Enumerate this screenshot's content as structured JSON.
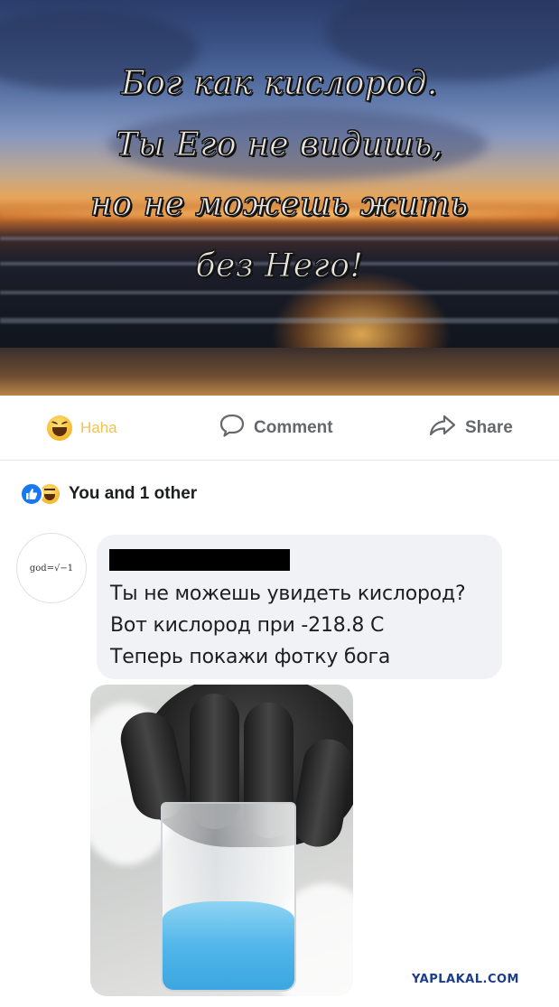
{
  "post": {
    "quote_lines": [
      "Бог как кислород.",
      "Ты Его не видишь,",
      "но не можешь жить",
      "без Него!"
    ]
  },
  "actions": {
    "haha_label": "Haha",
    "comment_label": "Comment",
    "share_label": "Share"
  },
  "reactions": {
    "summary": "You and 1 other"
  },
  "comment": {
    "avatar_text": "god=√−1",
    "lines": [
      "Ты не можешь увидеть кислород?",
      "Вот кислород при -218.8 C",
      "Теперь покажи фотку бога"
    ]
  },
  "watermark": "YAPLAKAL.COM",
  "colors": {
    "link_blue": "#1877f2",
    "haha_yellow": "#f0c34d",
    "bubble_bg": "#f0f2f5",
    "muted_text": "#65676b"
  },
  "icons": [
    "haha-emoji-icon",
    "comment-icon",
    "share-icon",
    "like-reaction-icon",
    "haha-reaction-icon"
  ]
}
